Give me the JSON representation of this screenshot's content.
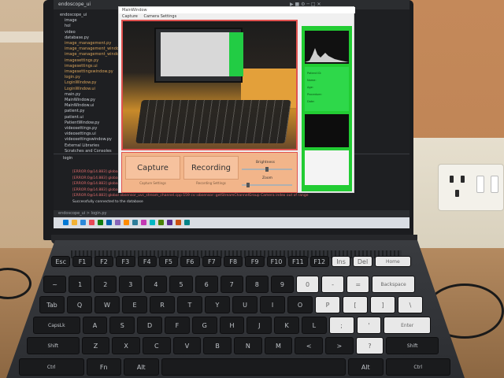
{
  "ide": {
    "title": "endoscope_ui",
    "tree": [
      {
        "label": "endoscope_ui",
        "color": "white"
      },
      {
        "label": "image",
        "color": "white"
      },
      {
        "label": "hol",
        "color": "white"
      },
      {
        "label": "video",
        "color": "white"
      },
      {
        "label": "database.py",
        "color": "white"
      },
      {
        "label": "image_management.py",
        "color": "orange"
      },
      {
        "label": "image_management_window.py",
        "color": "orange"
      },
      {
        "label": "image_management_window.ui",
        "color": "orange"
      },
      {
        "label": "imagesettings.py",
        "color": "orange"
      },
      {
        "label": "imagesettings.ui",
        "color": "orange"
      },
      {
        "label": "imagesettingswindow.py",
        "color": "orange"
      },
      {
        "label": "login.py",
        "color": "orange"
      },
      {
        "label": "LoginWindow.py",
        "color": "orange"
      },
      {
        "label": "LoginWindow.ui",
        "color": "orange"
      },
      {
        "label": "main.py",
        "color": "white"
      },
      {
        "label": "MainWindow.py",
        "color": "white"
      },
      {
        "label": "MainWindow.ui",
        "color": "white"
      },
      {
        "label": "patient.py",
        "color": "white"
      },
      {
        "label": "patient.ui",
        "color": "white"
      },
      {
        "label": "PatientWindow.py",
        "color": "white"
      },
      {
        "label": "videosettings.py",
        "color": "white"
      },
      {
        "label": "videosettings.ui",
        "color": "white"
      },
      {
        "label": "videosettingswindow.py",
        "color": "white"
      },
      {
        "label": "External Libraries",
        "color": "white"
      },
      {
        "label": "Scratches and Consoles",
        "color": "white"
      }
    ],
    "run_tab": "login",
    "logs": [
      {
        "text": "[ERROR:0@14.883] global obsensor_uvc_stream_channel.cpp:159 cv::obsensor::getStreamChannelGroup Camera index out of range",
        "color": "red"
      },
      {
        "text": "[ERROR:0@14.883] global obsensor_uvc_stream_channel.cpp:159 cv::obsensor::getStreamChannelGroup Camera index out of range",
        "color": "red"
      },
      {
        "text": "[ERROR:0@14.883] global obsensor_uvc_stream_channel.cpp:159 cv::obsensor::getStreamChannelGroup Camera index out of range",
        "color": "red"
      },
      {
        "text": "[ERROR:0@14.883] global obsensor_uvc_stream_channel.cpp:159 cv::obsensor::getStreamChannelGroup Camera index out of range",
        "color": "red"
      },
      {
        "text": "[ERROR:0@14.883] global obsensor_uvc_stream_channel.cpp:159 cv::obsensor::getStreamChannelGroup Camera index out of range",
        "color": "red"
      },
      {
        "text": "Successfully connected to the database",
        "color": "white"
      }
    ],
    "status": "endoscope_ui > login.py"
  },
  "app": {
    "title": "MainWindow",
    "menu": [
      "Capture",
      "Camera Settings"
    ],
    "capture_label": "Capture",
    "recording_label": "Recording",
    "capture_sub": "Capture Settings",
    "recording_sub": "Recording Settings",
    "brightness_label": "Brightness",
    "zoom_label": "Zoom",
    "brightness_value": 0.5,
    "zoom_value": 0.1,
    "info_lines": [
      "Patient ID:",
      "Name:",
      "Age:",
      "Procedure:",
      "Date:"
    ]
  },
  "keyboard": {
    "row1": [
      "Esc",
      "F1",
      "F2",
      "F3",
      "F4",
      "F5",
      "F6",
      "F7",
      "F8",
      "F9",
      "F10",
      "F11",
      "F12",
      "Ins",
      "Del",
      "Home"
    ],
    "row2": [
      "~",
      "1",
      "2",
      "3",
      "4",
      "5",
      "6",
      "7",
      "8",
      "9",
      "0",
      "-",
      "=",
      "Backspace"
    ],
    "row3": [
      "Tab",
      "Q",
      "W",
      "E",
      "R",
      "T",
      "Y",
      "U",
      "I",
      "O",
      "P",
      "[",
      "]",
      "\\"
    ],
    "row4": [
      "CapsLk",
      "A",
      "S",
      "D",
      "F",
      "G",
      "H",
      "J",
      "K",
      "L",
      ";",
      "'",
      "Enter"
    ],
    "row5": [
      "Shift",
      "Z",
      "X",
      "C",
      "V",
      "B",
      "N",
      "M",
      "<",
      ">",
      "?",
      "Shift"
    ],
    "row6": [
      "Ctrl",
      "Fn",
      "Alt",
      "",
      "Alt",
      "Ctrl"
    ]
  },
  "colors": {
    "video_border": "#e0524f",
    "side_panel": "#22cc33",
    "controls_bg": "#f2b58a"
  }
}
